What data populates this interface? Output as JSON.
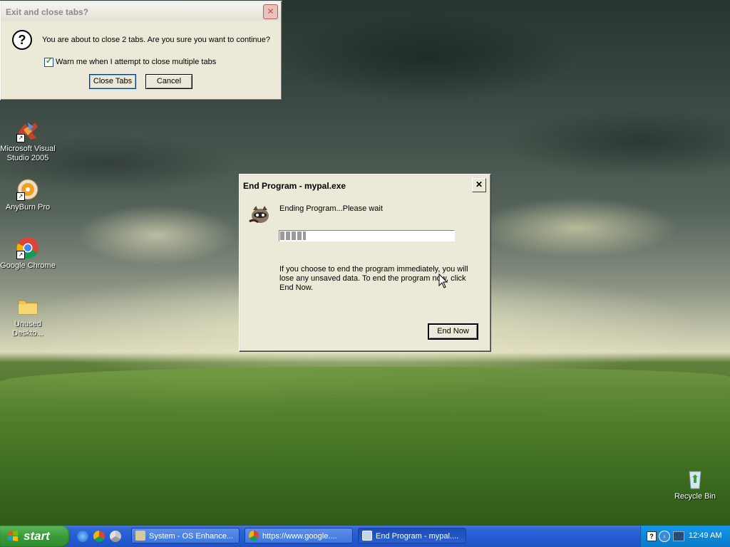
{
  "desktop": {
    "icons": [
      {
        "label": "Microsoft Visual Studio 2005"
      },
      {
        "label": "AnyBurn Pro"
      },
      {
        "label": "Google Chrome"
      },
      {
        "label": "Unused Deskto..."
      },
      {
        "label": "Recycle Bin"
      }
    ]
  },
  "close_tabs_dialog": {
    "title": "Exit and close tabs?",
    "message": "You are about to close 2 tabs. Are you sure you want to continue?",
    "checkbox_label": "Warn me when I attempt to close multiple tabs",
    "checkbox_checked": true,
    "confirm_label": "Close Tabs",
    "cancel_label": "Cancel",
    "close_glyph": "✕",
    "icon": "question-icon"
  },
  "end_program_dialog": {
    "title": "End Program - mypal.exe",
    "status": "Ending Program...Please wait",
    "progress_fraction": 0.15,
    "description": "If you choose to end the program immediately, you will lose any unsaved data. To end the program now, click End Now.",
    "end_now_label": "End Now",
    "close_glyph": "✕",
    "icon": "raccoon-icon"
  },
  "taskbar": {
    "start_label": "start",
    "quick_launch": [
      "ie-icon",
      "chrome-icon",
      "chrome-alt-icon"
    ],
    "tasks": [
      {
        "label": "System - OS Enhance...",
        "icon": "system-icon",
        "active": false
      },
      {
        "label": "https://www.google....",
        "icon": "chrome-icon",
        "active": false
      },
      {
        "label": "End Program - mypal....",
        "icon": "window-icon",
        "active": true
      }
    ],
    "clock": "12:49 AM"
  }
}
